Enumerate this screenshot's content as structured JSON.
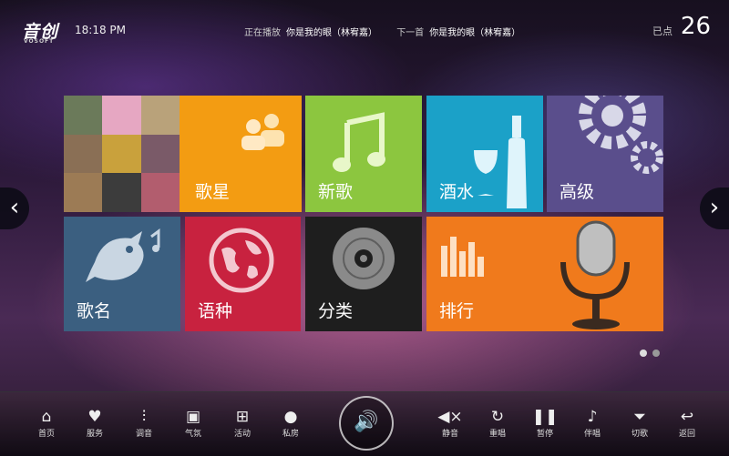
{
  "header": {
    "logo_text": "音创",
    "logo_sub": "VOSOFT",
    "time": "18:18 PM",
    "now_playing_label": "正在播放",
    "now_playing_title": "你是我的眼（林宥嘉）",
    "next_label": "下一首",
    "next_title": "你是我的眼（林宥嘉）",
    "ordered_label": "已点",
    "ordered_count": "26"
  },
  "tiles": {
    "singer": {
      "label": "歌星",
      "color": "#f39c12"
    },
    "new_song": {
      "label": "新歌",
      "color": "#8cc63f"
    },
    "drinks": {
      "label": "酒水",
      "color": "#1ba1c8"
    },
    "advanced": {
      "label": "高级",
      "color": "#5a4e8c"
    },
    "song_name": {
      "label": "歌名",
      "color": "#3b5f80"
    },
    "language": {
      "label": "语种",
      "color": "#c8223f"
    },
    "category": {
      "label": "分类",
      "color": "#1e1e1e"
    },
    "ranking": {
      "label": "排行",
      "color": "#f07a1c"
    }
  },
  "nav": {
    "prev_icon": "chevron-left-icon",
    "next_icon": "chevron-right-icon"
  },
  "bottom": {
    "home": "首页",
    "service": "服务",
    "sound": "调音",
    "atmosphere": "气氛",
    "activity": "活动",
    "private_room": "私房",
    "mute": "静音",
    "replay": "重唱",
    "pause": "暂停",
    "accompany": "伴唱",
    "skip": "切歌",
    "back": "返回"
  }
}
